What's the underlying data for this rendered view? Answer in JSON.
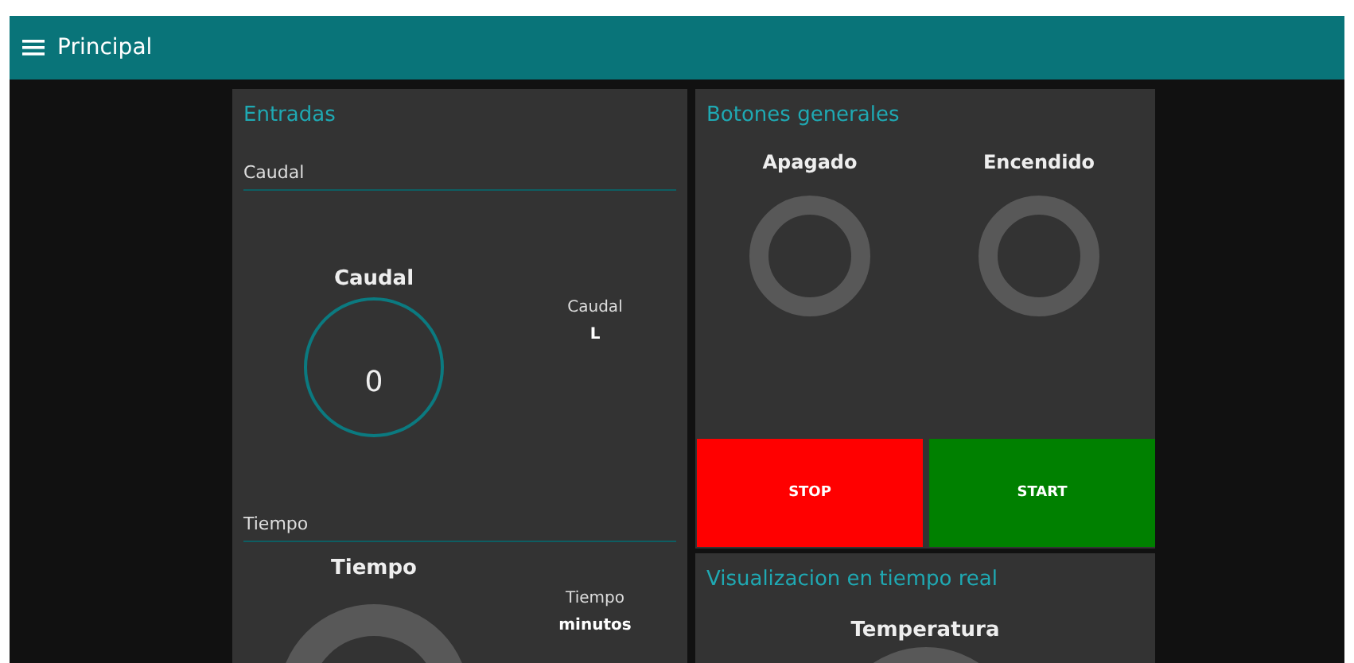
{
  "header": {
    "title": "Principal"
  },
  "inputs": {
    "title": "Entradas",
    "groups": [
      {
        "label": "Caudal",
        "gauge": {
          "kind": "ring",
          "title": "Caudal",
          "value": "0"
        },
        "side": {
          "label": "Caudal",
          "unit": "L"
        }
      },
      {
        "label": "Tiempo",
        "gauge": {
          "kind": "donut",
          "title": "Tiempo"
        },
        "side": {
          "label": "Tiempo",
          "unit": "minutos"
        }
      }
    ]
  },
  "buttons_card": {
    "title": "Botones generales",
    "indicators": [
      {
        "label": "Apagado",
        "on": false
      },
      {
        "label": "Encendido",
        "on": false
      }
    ],
    "buttons": [
      {
        "label": "STOP",
        "color": "#ff0000"
      },
      {
        "label": "START",
        "color": "#008000"
      }
    ]
  },
  "realtime": {
    "title": "Visualizacion en tiempo real",
    "gauge": {
      "kind": "donut",
      "title": "Temperatura"
    }
  }
}
